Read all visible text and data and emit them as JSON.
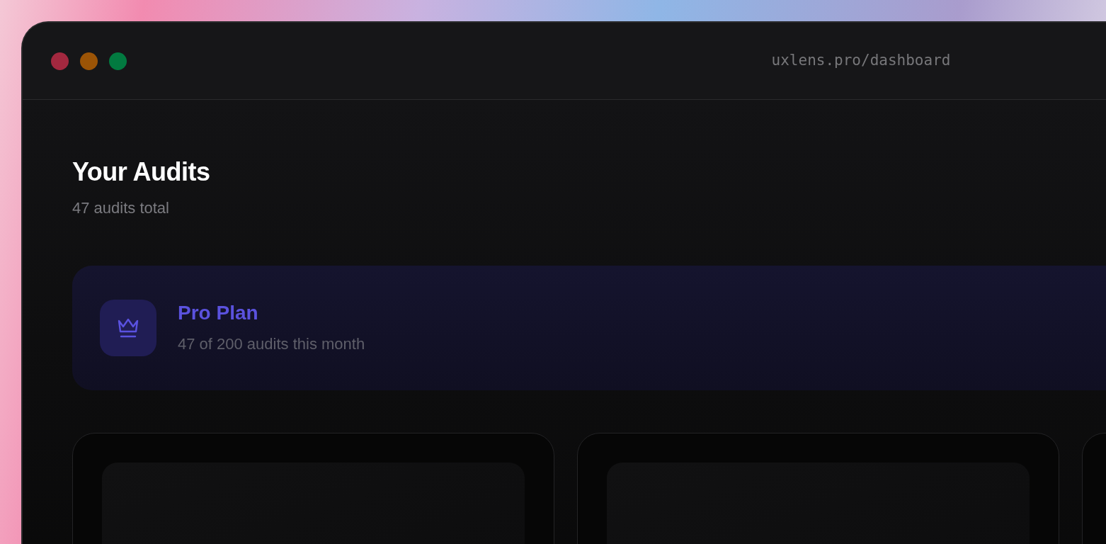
{
  "window": {
    "url": "uxlens.pro/dashboard"
  },
  "header": {
    "title": "Your Audits",
    "subtitle": "47 audits total"
  },
  "plan": {
    "name": "Pro Plan",
    "usage": "47 of 200 audits this month"
  }
}
